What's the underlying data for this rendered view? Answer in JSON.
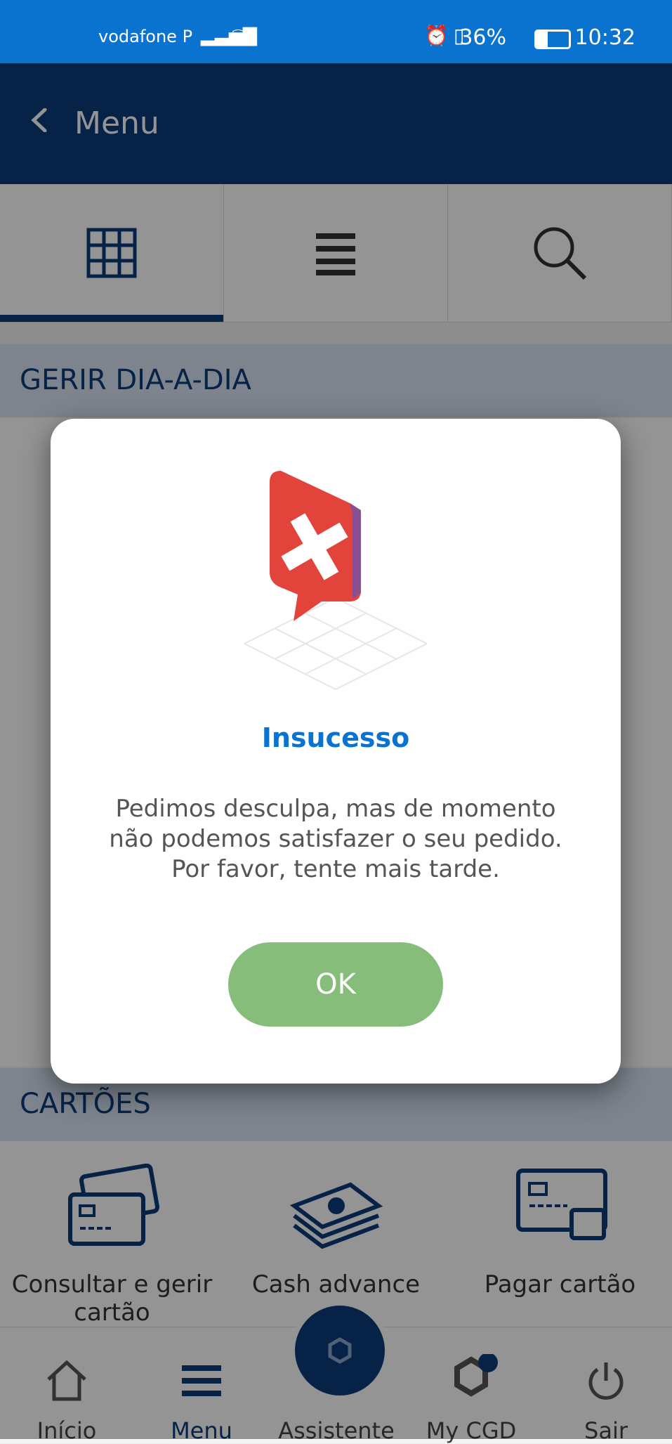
{
  "status_bar": {
    "carrier": "vodafone P",
    "battery": "36%",
    "time": "10:32"
  },
  "header": {
    "title": "Menu"
  },
  "tabs": [
    "grid-tab",
    "list-tab",
    "search-tab"
  ],
  "sections": {
    "daily": "GERIR DIA-A-DIA",
    "cards": "CARTÕES"
  },
  "cards": [
    {
      "label": "Consultar e gerir cartão"
    },
    {
      "label": "Cash advance"
    },
    {
      "label": "Pagar cartão"
    }
  ],
  "bottom_nav": [
    {
      "label": "Início",
      "icon": "home-icon"
    },
    {
      "label": "Menu",
      "icon": "menu-icon",
      "active": true
    },
    {
      "label": "Assistente",
      "icon": "assistant-icon"
    },
    {
      "label": "My CGD",
      "icon": "cgd-logo-icon"
    },
    {
      "label": "Sair",
      "icon": "power-icon"
    }
  ],
  "dialog": {
    "title": "Insucesso",
    "message_l1": "Pedimos desculpa, mas de momento",
    "message_l2": "não podemos satisfazer o seu pedido.",
    "message_l3": "Por favor, tente mais tarde.",
    "ok_label": "OK"
  },
  "colors": {
    "primary": "#0b3d7a",
    "accent": "#0a72cf",
    "ok": "#86bd7b",
    "error": "#e2433b"
  }
}
